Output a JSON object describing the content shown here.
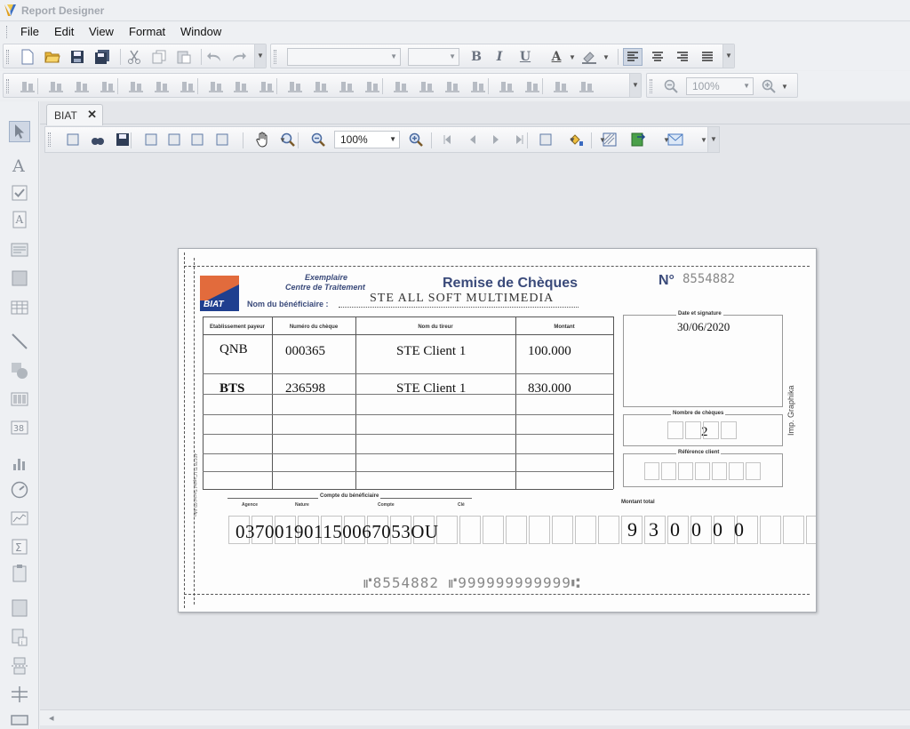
{
  "window": {
    "title": "Report Designer"
  },
  "menu": {
    "items": [
      "File",
      "Edit",
      "View",
      "Format",
      "Window"
    ]
  },
  "toolbar": {
    "bold_label": "B",
    "italic_label": "I",
    "underline_label": "U",
    "font_color_label": "A",
    "zoom_value": "100%"
  },
  "tabs": [
    {
      "label": "BIAT",
      "close": "✕"
    }
  ],
  "viewer": {
    "zoom_value": "100%"
  },
  "cheque": {
    "bank_logo_text": "BIAT",
    "copy_label_line1": "Exemplaire",
    "copy_label_line2": "Centre de Traitement",
    "title": "Remise de Chèques",
    "number_label": "N°",
    "number": "8554882",
    "beneficiary_label": "Nom du bénéficiaire :",
    "beneficiary_name": "STE ALL SOFT MULTIMEDIA",
    "columns": [
      "Etablissement payeur",
      "Numéro du chèque",
      "Nom du tireur",
      "Montant"
    ],
    "rows": [
      {
        "bank": "QNB",
        "cheque_number": "000365",
        "drawer": "STE Client 1",
        "amount": "100.000"
      },
      {
        "bank": "BTS",
        "cheque_number": "236598",
        "drawer": "STE Client 1",
        "amount": "830.000"
      }
    ],
    "date_label": "Date et signature",
    "date": "30/06/2020",
    "count_label": "Nombre de chèques",
    "count": "2",
    "client_ref_label": "Référence client",
    "account_label": "Compte du bénéficiaire",
    "account_sub_labels": [
      "Agence",
      "Nature",
      "Compte",
      "Clé"
    ],
    "account_number": "037001901150067053OU",
    "total_label": "Montant total",
    "total_digits": [
      "9",
      "3",
      "0",
      "0",
      "0",
      "0"
    ],
    "side_text": "Imp. Graphika",
    "vertical_small_text": "40178 TU Capital Social 69 4Ao",
    "micr_line": "⑈8554882 ⑈999999999999⑆"
  }
}
